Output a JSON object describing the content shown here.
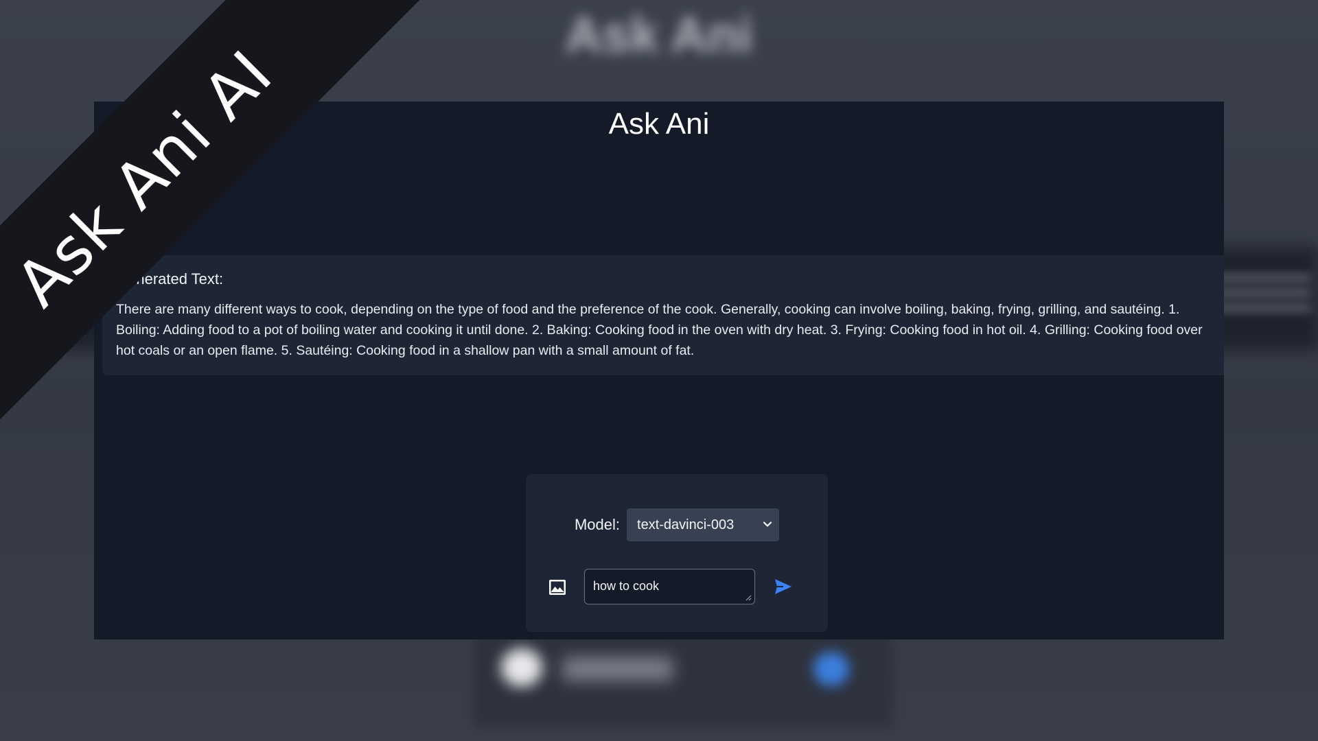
{
  "banner": {
    "text": "Ask Ani AI"
  },
  "background": {
    "blurred_title": "Ask Ani"
  },
  "app": {
    "title": "Ask Ani"
  },
  "output": {
    "heading": "Generated Text:",
    "body": "There are many different ways to cook, depending on the type of food and the preference of the cook. Generally, cooking can involve boiling, baking, frying, grilling, and sautéing. 1. Boiling: Adding food to a pot of boiling water and cooking it until done. 2. Baking: Cooking food in the oven with dry heat. 3. Frying: Cooking food in hot oil. 4. Grilling: Cooking food over hot coals or an open flame. 5. Sautéing: Cooking food in a shallow pan with a small amount of fat."
  },
  "controls": {
    "model_label": "Model:",
    "model_value": "text-davinci-003",
    "prompt_value": "how to cook",
    "image_icon": "image-icon",
    "send_icon": "send-icon",
    "chevron_icon": "chevron-down-icon"
  },
  "colors": {
    "app_background": "#141a28",
    "card_background": "#1e2636",
    "panel_background": "#1e2535",
    "select_background": "#374152",
    "accent": "#3b82f6",
    "banner": "#15171c"
  }
}
